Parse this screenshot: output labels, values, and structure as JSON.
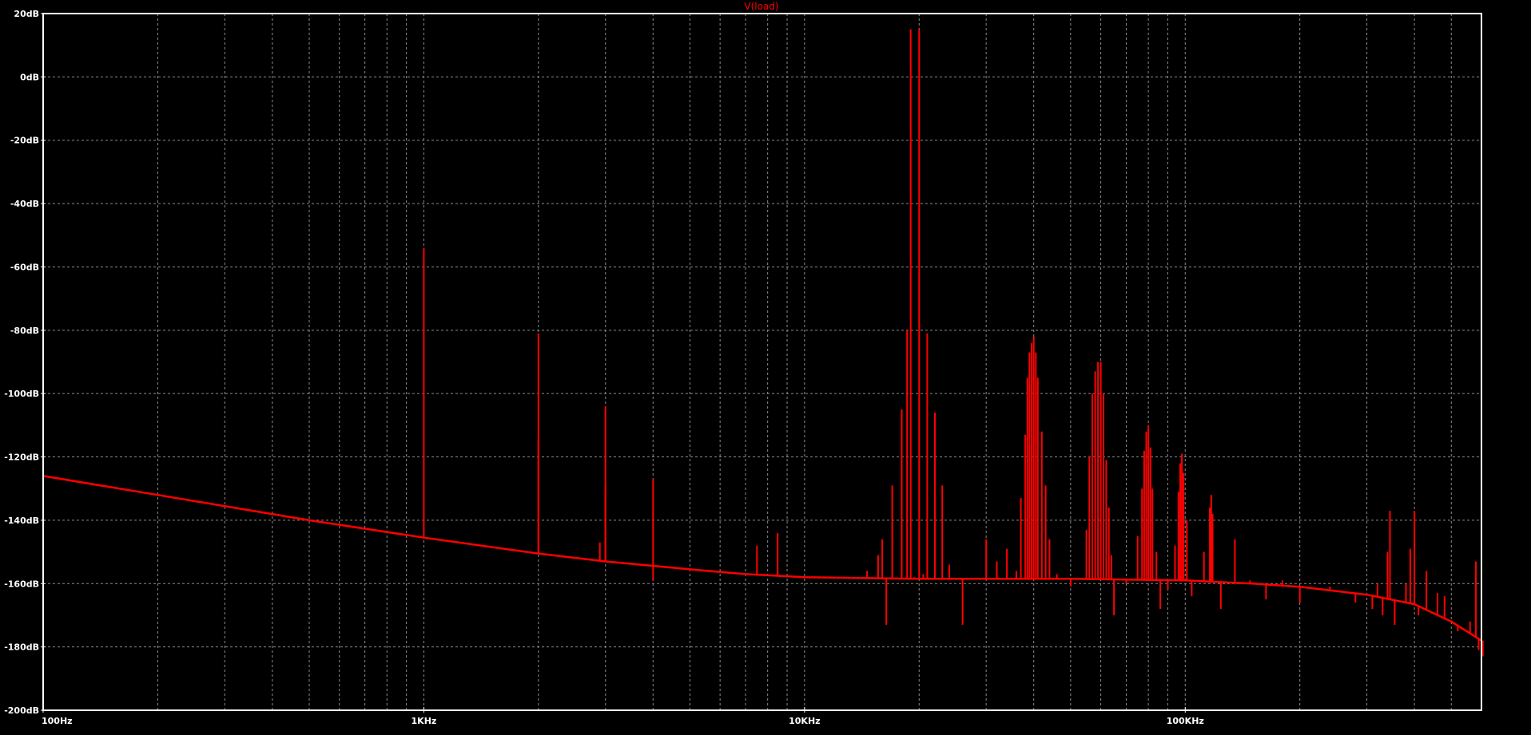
{
  "window": {
    "trace_title": "V(load)",
    "trace_color": "#ff0000",
    "background_color": "#000000",
    "axes_color": "#ffffff",
    "grid_color": "#8c8c8c"
  },
  "chart_data": {
    "type": "line",
    "title": "V(load)",
    "xscale": "log",
    "xlim": [
      100,
      600000
    ],
    "ylim": [
      -200,
      20
    ],
    "grid": true,
    "x_ticks": [
      {
        "value": 100,
        "label": "100Hz"
      },
      {
        "value": 1000,
        "label": "1KHz"
      },
      {
        "value": 10000,
        "label": "10KHz"
      },
      {
        "value": 100000,
        "label": "100KHz"
      }
    ],
    "y_ticks": [
      {
        "value": 20,
        "label": "20dB"
      },
      {
        "value": 0,
        "label": "0dB"
      },
      {
        "value": -20,
        "label": "-20dB"
      },
      {
        "value": -40,
        "label": "-40dB"
      },
      {
        "value": -60,
        "label": "-60dB"
      },
      {
        "value": -80,
        "label": "-80dB"
      },
      {
        "value": -100,
        "label": "-100dB"
      },
      {
        "value": -120,
        "label": "-120dB"
      },
      {
        "value": -140,
        "label": "-140dB"
      },
      {
        "value": -160,
        "label": "-160dB"
      },
      {
        "value": -180,
        "label": "-180dB"
      },
      {
        "value": -200,
        "label": "-200dB"
      }
    ],
    "series": [
      {
        "color": "#ff0000",
        "noise_floor": [
          [
            100,
            -126
          ],
          [
            200,
            -132
          ],
          [
            500,
            -140
          ],
          [
            1000,
            -145.5
          ],
          [
            2000,
            -150.5
          ],
          [
            3000,
            -153
          ],
          [
            5000,
            -155.5
          ],
          [
            7000,
            -157
          ],
          [
            10000,
            -158
          ],
          [
            20000,
            -158.5
          ],
          [
            50000,
            -158.5
          ],
          [
            100000,
            -159
          ],
          [
            150000,
            -160
          ],
          [
            200000,
            -161
          ],
          [
            300000,
            -163.5
          ],
          [
            400000,
            -166.5
          ],
          [
            500000,
            -172
          ],
          [
            600000,
            -178
          ]
        ],
        "spikes": [
          [
            1000,
            -54
          ],
          [
            2000,
            -81
          ],
          [
            2000,
            -115
          ],
          [
            2900,
            -147
          ],
          [
            3000,
            -104
          ],
          [
            3000,
            -129
          ],
          [
            4000,
            -127
          ],
          [
            4000,
            -159
          ],
          [
            7500,
            -148
          ],
          [
            8500,
            -144
          ],
          [
            14600,
            -156
          ],
          [
            15600,
            -151
          ],
          [
            16000,
            -146
          ],
          [
            16400,
            -173
          ],
          [
            17000,
            -129
          ],
          [
            18000,
            -105
          ],
          [
            18600,
            -80
          ],
          [
            19000,
            15
          ],
          [
            19400,
            -158
          ],
          [
            20000,
            15
          ],
          [
            20500,
            -157
          ],
          [
            21000,
            -81
          ],
          [
            22000,
            -106
          ],
          [
            23000,
            -129
          ],
          [
            24000,
            -154
          ],
          [
            26000,
            -173
          ],
          [
            30000,
            -146
          ],
          [
            32000,
            -153
          ],
          [
            34000,
            -149
          ],
          [
            36000,
            -156
          ],
          [
            37000,
            -133
          ],
          [
            38000,
            -113
          ],
          [
            38500,
            -95
          ],
          [
            39000,
            -87
          ],
          [
            39500,
            -84
          ],
          [
            40000,
            -82
          ],
          [
            40500,
            -87
          ],
          [
            41000,
            -95
          ],
          [
            42000,
            -112
          ],
          [
            43000,
            -129
          ],
          [
            44000,
            -146
          ],
          [
            46000,
            -157
          ],
          [
            50000,
            -161
          ],
          [
            55000,
            -143
          ],
          [
            56000,
            -120
          ],
          [
            57000,
            -100
          ],
          [
            58000,
            -93
          ],
          [
            59000,
            -90
          ],
          [
            60000,
            -90
          ],
          [
            61000,
            -100
          ],
          [
            62000,
            -121
          ],
          [
            63000,
            -136
          ],
          [
            64000,
            -151
          ],
          [
            65000,
            -170
          ],
          [
            70000,
            -160
          ],
          [
            75000,
            -145
          ],
          [
            77000,
            -130
          ],
          [
            78000,
            -118
          ],
          [
            79000,
            -112
          ],
          [
            80000,
            -110
          ],
          [
            81000,
            -117
          ],
          [
            82000,
            -130
          ],
          [
            84000,
            -150
          ],
          [
            86000,
            -168
          ],
          [
            90000,
            -162
          ],
          [
            94000,
            -148
          ],
          [
            96000,
            -131
          ],
          [
            97000,
            -122
          ],
          [
            98000,
            -119
          ],
          [
            99000,
            -125
          ],
          [
            101000,
            -140
          ],
          [
            104000,
            -164
          ],
          [
            112000,
            -150
          ],
          [
            116000,
            -136
          ],
          [
            117000,
            -132
          ],
          [
            118000,
            -138
          ],
          [
            124000,
            -168
          ],
          [
            135000,
            -146
          ],
          [
            148000,
            -159
          ],
          [
            163000,
            -165
          ],
          [
            180000,
            -159
          ],
          [
            200000,
            -166
          ],
          [
            240000,
            -161
          ],
          [
            280000,
            -166
          ],
          [
            310000,
            -168
          ],
          [
            320000,
            -160
          ],
          [
            330000,
            -170
          ],
          [
            340000,
            -150
          ],
          [
            345000,
            -137
          ],
          [
            355000,
            -173
          ],
          [
            380000,
            -160
          ],
          [
            390000,
            -149
          ],
          [
            400000,
            -137
          ],
          [
            410000,
            -170
          ],
          [
            430000,
            -156
          ],
          [
            460000,
            -163
          ],
          [
            480000,
            -164
          ],
          [
            520000,
            -175
          ],
          [
            560000,
            -172
          ],
          [
            580000,
            -153
          ],
          [
            590000,
            -181
          ],
          [
            600000,
            -161
          ],
          [
            605000,
            -183
          ]
        ]
      }
    ]
  }
}
